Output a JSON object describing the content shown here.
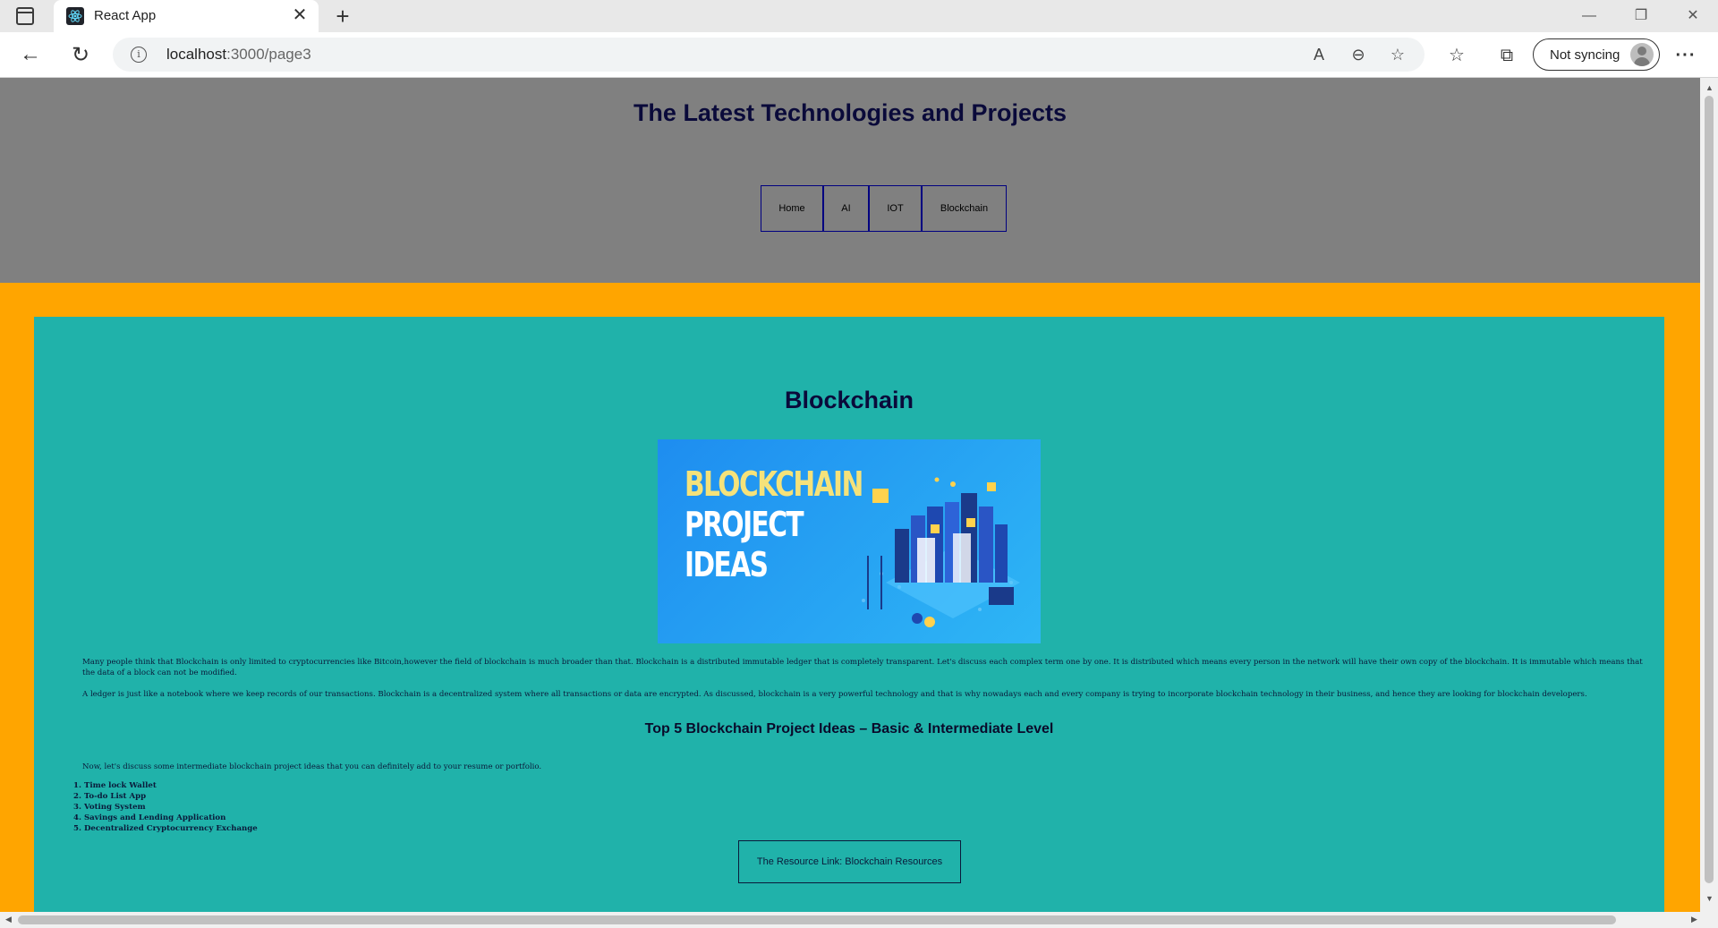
{
  "browser": {
    "tab_title": "React App",
    "url_host": "localhost",
    "url_path": ":3000/page3",
    "sync_label": "Not syncing"
  },
  "site": {
    "title": "The Latest Technologies and Projects",
    "nav": [
      {
        "label": "Home"
      },
      {
        "label": "AI"
      },
      {
        "label": "IOT"
      },
      {
        "label": "Blockchain"
      }
    ]
  },
  "main": {
    "section_title": "Blockchain",
    "image_text": [
      "BLOCKCHAIN",
      "PROJECT",
      "IDEAS"
    ],
    "paragraphs": [
      "Many people think that Blockchain is only limited to cryptocurrencies like Bitcoin,however the field of blockchain is much broader than that. Blockchain is a distributed immutable ledger that is completely transparent. Let's discuss each complex term one by one. It is distributed which means every person in the network will have their own copy of the blockchain. It is immutable which means that the data of a block can not be modified.",
      "A ledger is just like a notebook where we keep records of our transactions. Blockchain is a decentralized system where all transactions or data are encrypted. As discussed, blockchain is a very powerful technology and that is why nowadays each and every company is trying to incorporate blockchain technology in their business, and hence they are looking for blockchain developers."
    ],
    "subtitle": "Top 5 Blockchain Project Ideas – Basic & Intermediate Level",
    "intro": "Now, let's discuss some intermediate blockchain project ideas that you can definitely add to your resume or portfolio.",
    "ideas": [
      "1. Time lock Wallet",
      "2. To-do List App",
      "3. Voting System",
      "4. Savings and Lending Application",
      "5. Decentralized Cryptocurrency Exchange"
    ],
    "resource_link": "The Resource Link: Blockchain Resources"
  },
  "colors": {
    "header_bg": "#808080",
    "frame_bg": "#ffa500",
    "content_bg": "#20b2aa",
    "nav_border": "#000080"
  }
}
